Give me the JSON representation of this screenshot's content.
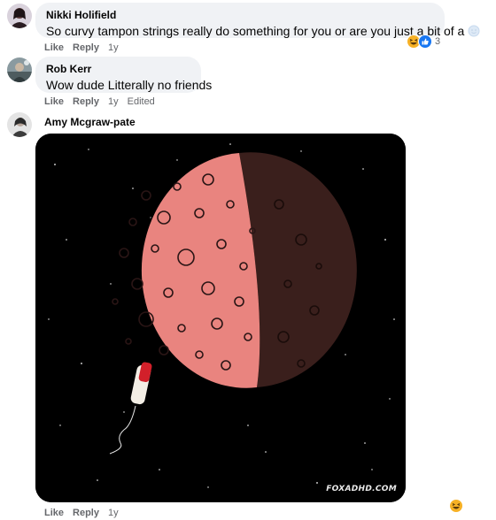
{
  "comments": [
    {
      "author": "Nikki Holifield",
      "text": "So curvy tampon strings really do something for you or are you just a bit of a",
      "like_label": "Like",
      "reply_label": "Reply",
      "time": "1y",
      "reaction_count": "3",
      "reaction_icons": [
        "haha-emoji-icon",
        "like-reaction-icon"
      ]
    },
    {
      "author": "Rob Kerr",
      "text": "Wow dude Litterally no friends",
      "like_label": "Like",
      "reply_label": "Reply",
      "time": "1y",
      "edited_label": "Edited"
    },
    {
      "author": "Amy Mcgraw-pate",
      "attachment": {
        "type": "gif",
        "watermark": "FOXADHD.COM",
        "background": "#000000",
        "moon_color": "#e9847f",
        "shadow_color": "#3a1f1c"
      },
      "like_label": "Like",
      "reply_label": "Reply",
      "time": "1y",
      "reaction_icons": [
        "haha-emoji-icon"
      ]
    }
  ],
  "colors": {
    "bubble": "#f0f2f5",
    "secondary_text": "#65676b",
    "like_blue": "#1877f2",
    "haha_yellow": "#f7b125"
  }
}
